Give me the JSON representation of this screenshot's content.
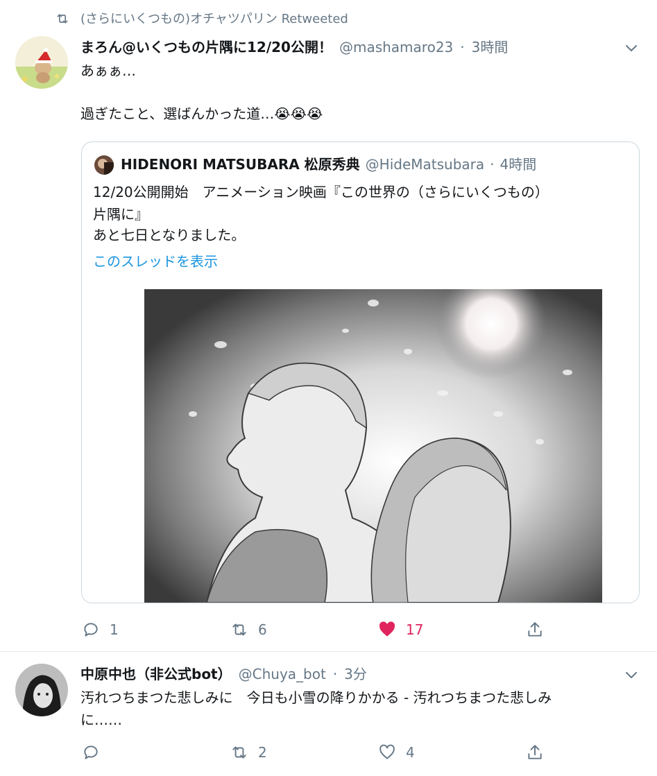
{
  "retweet_banner": {
    "text": "(さらにいくつもの)オチャツパリン Retweeted"
  },
  "tweet1": {
    "name": "まろん@いくつもの片隅に12/20公開！",
    "handle": "@mashamaro23",
    "dot": "·",
    "time": "3時間",
    "line1": "あぁぁ…",
    "line2": "過ぎたこと、選ばんかった道…😭😭😭",
    "quote": {
      "name": "HIDENORI MATSUBARA 松原秀典",
      "handle": "@HideMatsubara",
      "dot": "·",
      "time": "4時間",
      "text_line1": "12/20公開開始　アニメーション映画『この世界の（さらにいくつもの）",
      "text_line2": "片隅に』",
      "text_line3": "あと七日となりました。",
      "thread_link": "このスレッドを表示"
    },
    "actions": {
      "replies": "1",
      "retweets": "6",
      "likes": "17"
    }
  },
  "tweet2": {
    "name": "中原中也（非公式bot）",
    "handle": "@Chuya_bot",
    "dot": "·",
    "time": "3分",
    "text_line1": "汚れつちまつた悲しみに　今日も小雪の降りかかる - 汚れつちまつた悲しみ",
    "text_line2": "に……",
    "actions": {
      "replies": "",
      "retweets": "2",
      "likes": "4"
    }
  },
  "colors": {
    "like_active": "#e0245e",
    "link": "#1b95e0",
    "muted": "#657786"
  }
}
